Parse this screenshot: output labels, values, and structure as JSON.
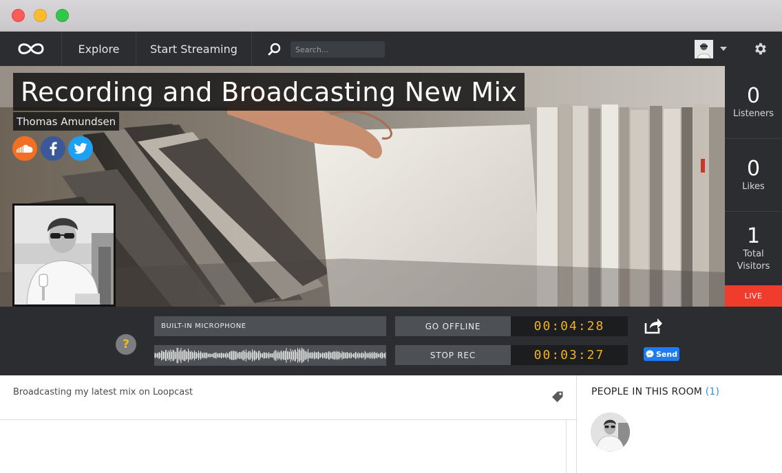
{
  "window": {
    "title": ""
  },
  "nav": {
    "logo_icon": "loopcast-logo-icon",
    "explore_label": "Explore",
    "start_streaming_label": "Start Streaming",
    "search_placeholder": "Search...",
    "search_value": ""
  },
  "broadcast": {
    "title": "Recording and Broadcasting New Mix",
    "author": "Thomas Amundsen",
    "social": [
      "soundcloud-icon",
      "facebook-icon",
      "twitter-icon"
    ]
  },
  "stats": {
    "listeners": {
      "value": "0",
      "label": "Listeners"
    },
    "likes": {
      "value": "0",
      "label": "Likes"
    },
    "visitors": {
      "value": "1",
      "label": "Total Visitors"
    },
    "live_label": "LIVE"
  },
  "controls": {
    "help_label": "?",
    "input_source": "BUILT-IN MICROPHONE",
    "go_offline_label": "GO OFFLINE",
    "stop_rec_label": "STOP REC",
    "broadcast_timer": "00:04:28",
    "recording_timer": "00:03:27",
    "send_label": "Send"
  },
  "description": "Broadcasting my latest mix on Loopcast",
  "room": {
    "title": "PEOPLE IN THIS ROOM",
    "count": "(1)"
  },
  "colors": {
    "nav_bg": "#2b2d30",
    "live_red": "#f03c2c",
    "timer_amber": "#f4b024",
    "link_blue": "#2f8ed8"
  }
}
